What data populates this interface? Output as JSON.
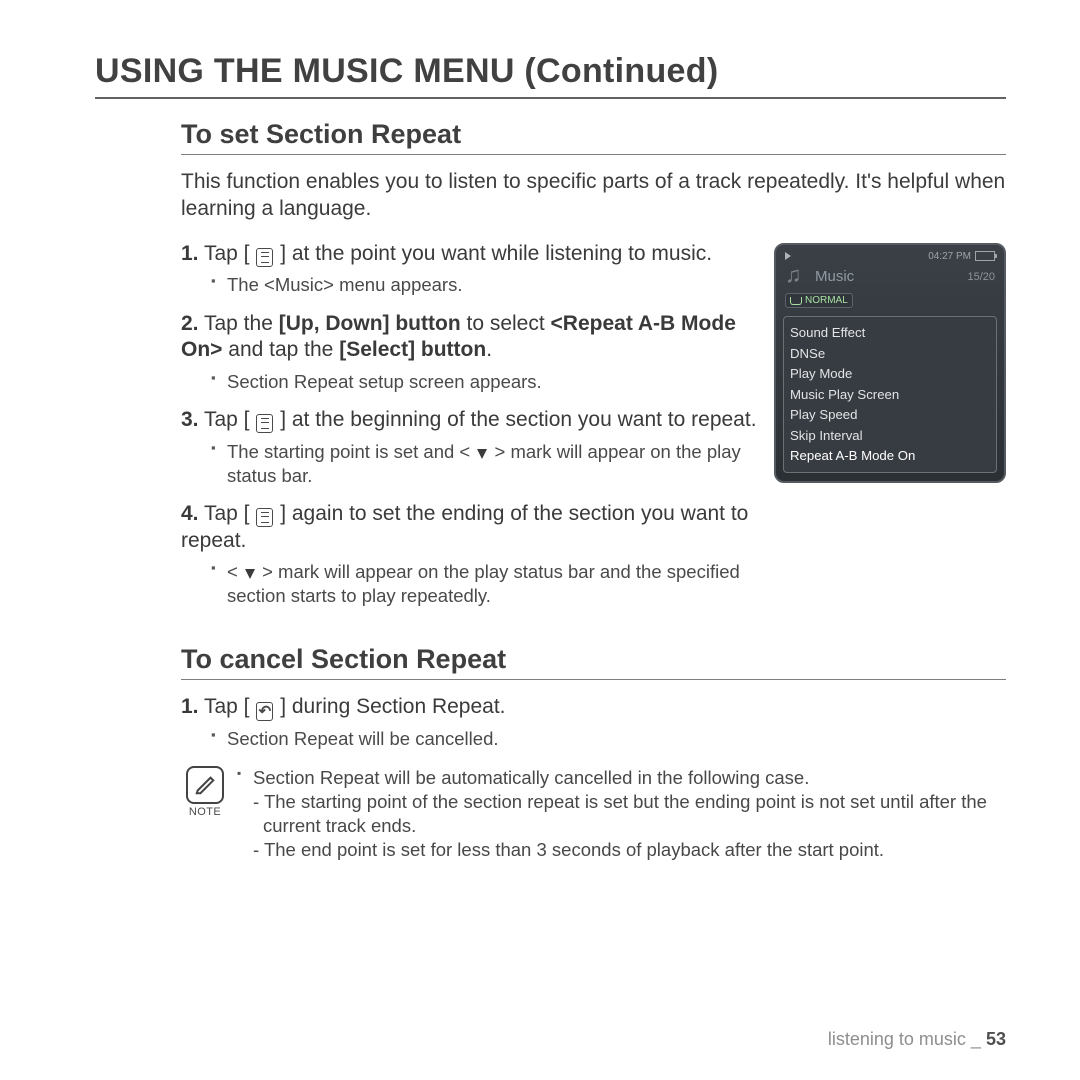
{
  "title": "USING THE MUSIC MENU (Continued)",
  "section1": {
    "heading": "To set Section Repeat",
    "intro": "This function enables you to listen to specific parts of a track repeatedly. It's helpful when learning a language.",
    "step1_a": "Tap [",
    "step1_b": "] at the point you want while listening to music.",
    "step1_sub": "The <Music> menu appears.",
    "step2_a": "Tap the ",
    "step2_b": "[Up, Down] button",
    "step2_c": " to select ",
    "step2_d": "<Repeat A-B Mode On>",
    "step2_e": " and tap the ",
    "step2_f": "[Select] button",
    "step2_g": ".",
    "step2_sub": "Section Repeat setup screen appears.",
    "step3_a": "Tap [",
    "step3_b": "] at the beginning of the section you want to repeat.",
    "step3_sub_a": "The starting point is set and < ",
    "step3_sub_b": " > mark will appear on the play status bar.",
    "step4_a": "Tap [",
    "step4_b": "] again to set the ending of the section you want to repeat.",
    "step4_sub_a": "< ",
    "step4_sub_b": " > mark will appear on the play status bar and the specified section starts to play repeatedly."
  },
  "section2": {
    "heading": "To cancel Section Repeat",
    "step1_a": "Tap [",
    "step1_b": "] during Section Repeat.",
    "step1_sub": "Section Repeat will be cancelled."
  },
  "note": {
    "label": "NOTE",
    "line1": "Section Repeat will be automatically cancelled in the following case.",
    "dash1": "- The starting point of the section repeat is set but the ending point is not set until after the current track ends.",
    "dash2": "- The end point is set for less than 3 seconds of playback after the start point."
  },
  "device": {
    "time": "04:27 PM",
    "music_label": "Music",
    "count": "15/20",
    "mode": "NORMAL",
    "menu": [
      "Sound Effect",
      "DNSe",
      "Play Mode",
      "Music Play Screen",
      "Play Speed",
      "Skip Interval",
      "Repeat A-B Mode On"
    ]
  },
  "footer": {
    "section": "listening to music _",
    "page": "53"
  }
}
